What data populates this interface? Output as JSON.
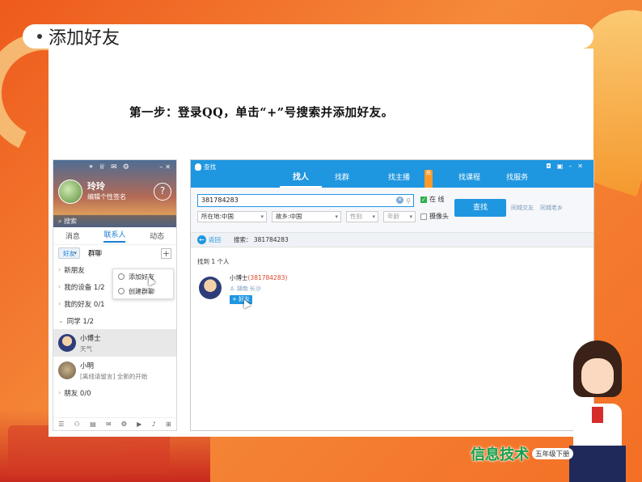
{
  "slide": {
    "title": "添加好友",
    "step": "第一步：登录QQ，单击“+”号搜索并添加好友。",
    "badge_main": "信息技术",
    "badge_sub": "五年级下册"
  },
  "qq_panel": {
    "nickname": "玲玲",
    "signature": "编辑个性签名",
    "weather": "?",
    "search_placeholder": "搜索",
    "tabs": [
      "消息",
      "联系人",
      "动态"
    ],
    "sub_tabs": [
      "好友",
      "群聊"
    ],
    "plus": "+",
    "groups": {
      "new_friend": "新朋友",
      "devices": "我的设备 1/2",
      "my_friends": "我的好友 0/1",
      "classmates": "同学 1/2",
      "friends": "朋友 0/0"
    },
    "friends": [
      {
        "name": "小博士",
        "status": "天气"
      },
      {
        "name": "小明",
        "status": "[离线请留言] 全新的开始"
      }
    ],
    "popup": [
      "添加好友",
      "创建群聊"
    ]
  },
  "find_window": {
    "title": "查找",
    "tabs": [
      "找人",
      "找群",
      "找主播",
      "找课程",
      "找服务"
    ],
    "hot_tag": "热",
    "keyword": "381784283",
    "online_label": "在 线",
    "camera_label": "摄像头",
    "selects": [
      "所在地:中国",
      "故乡:中国",
      "性别",
      "年龄"
    ],
    "find_button": "查找",
    "links": [
      "同城交友",
      "同城老乡"
    ],
    "back_label": "返回",
    "search_summary": "搜索： 381784283",
    "result_count": "找到 1 个人",
    "result": {
      "name": "小博士",
      "qq": "(381784283)",
      "location": "湖南 长沙",
      "add_label": "+ 好友"
    }
  }
}
